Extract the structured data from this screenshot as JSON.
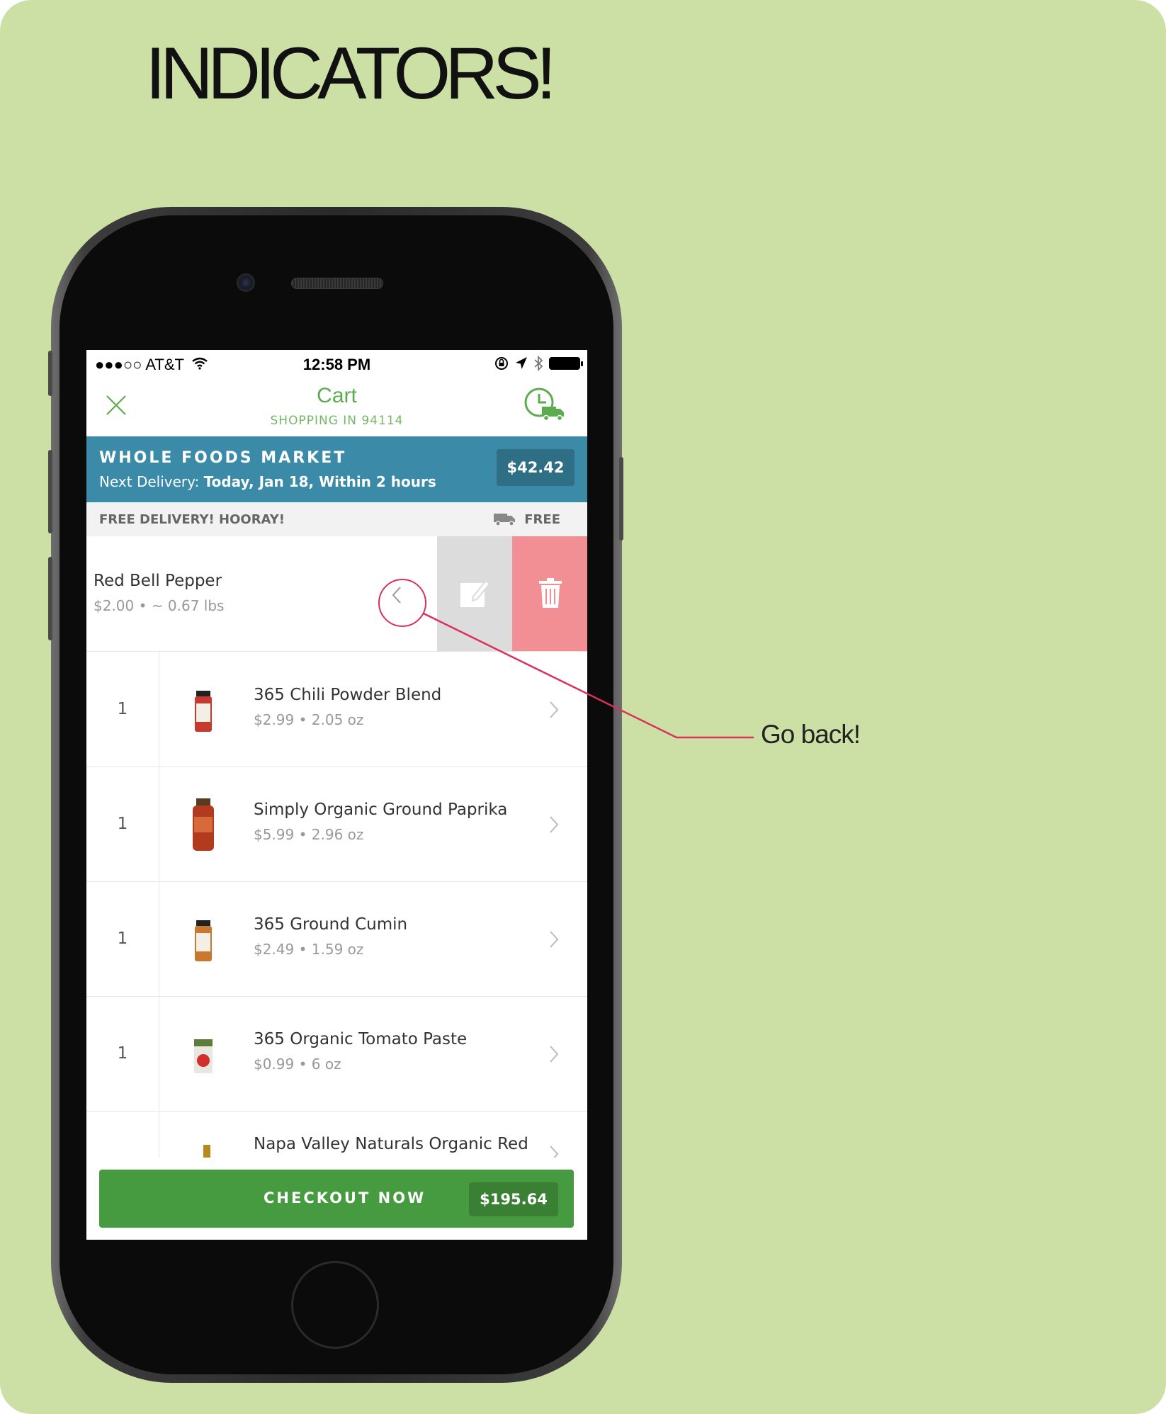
{
  "poster": {
    "heading": "INDICATORS!",
    "annotation_label": "Go back!",
    "background_color": "#cce0a6",
    "annotation_color": "#d9305c"
  },
  "status_bar": {
    "carrier": "●●●○○ AT&T",
    "time": "12:58 PM"
  },
  "nav": {
    "title": "Cart",
    "subtitle": "SHOPPING IN 94114",
    "close_icon": "close-icon",
    "schedule_icon": "clock-truck-icon"
  },
  "store": {
    "name": "WHOLE FOODS MARKET",
    "delivery_prefix": "Next Delivery:",
    "delivery_value": "Today, Jan 18, Within 2 hours",
    "total": "$42.42",
    "color": "#3a8aa8"
  },
  "free_delivery": {
    "message": "FREE DELIVERY! HOORAY!",
    "cost": "FREE"
  },
  "swiped_item": {
    "name": "Red Bell Pepper",
    "meta": "$2.00 • ~ 0.67 lbs"
  },
  "items": [
    {
      "qty": "1",
      "name": "365 Chili Powder Blend",
      "meta": "$2.99 • 2.05 oz"
    },
    {
      "qty": "1",
      "name": "Simply Organic Ground Paprika",
      "meta": "$5.99 • 2.96 oz"
    },
    {
      "qty": "1",
      "name": "365 Ground Cumin",
      "meta": "$2.49 • 1.59 oz"
    },
    {
      "qty": "1",
      "name": "365 Organic Tomato Paste",
      "meta": "$0.99 • 6 oz"
    },
    {
      "qty": "",
      "name": "Napa Valley Naturals Organic Red",
      "meta": ""
    }
  ],
  "checkout": {
    "label": "CHECKOUT NOW",
    "total": "$195.64",
    "color": "#469a3f"
  }
}
